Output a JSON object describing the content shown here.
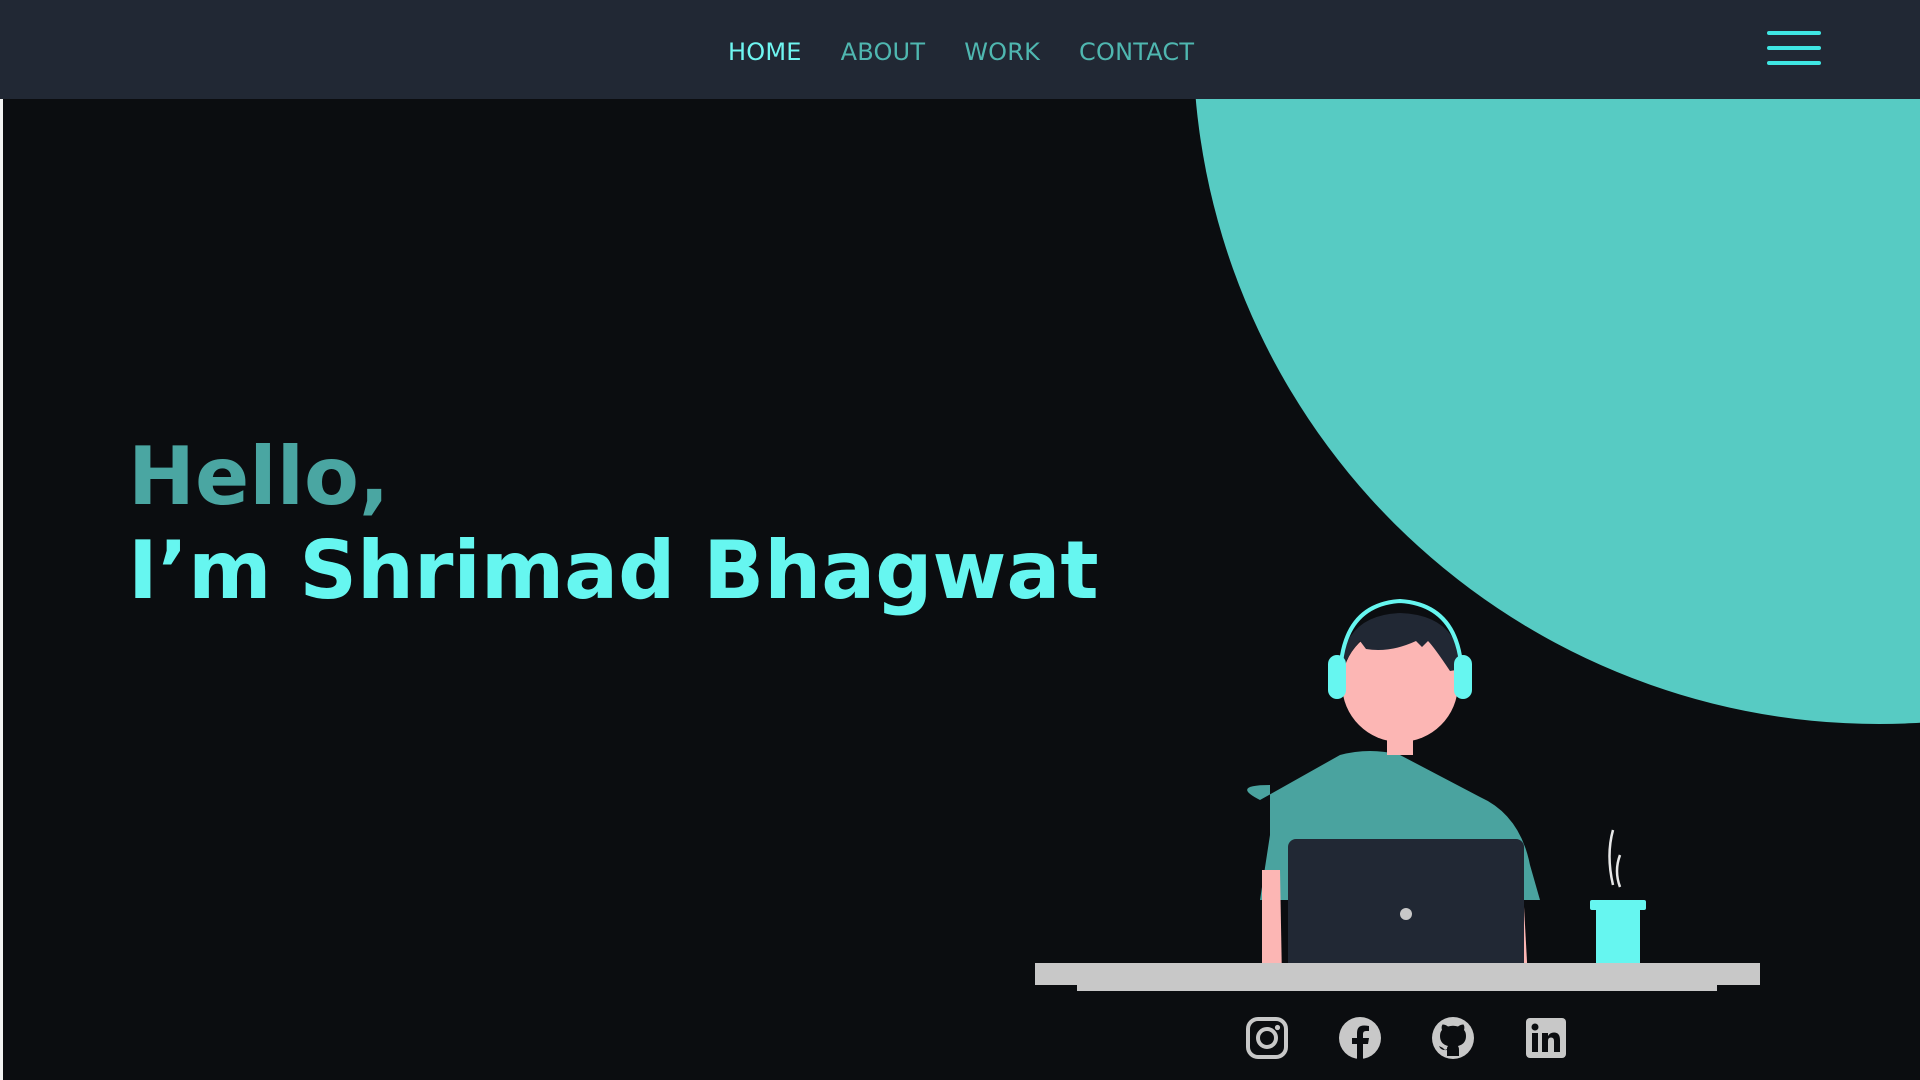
{
  "nav": {
    "links": [
      {
        "label": "HOME",
        "active": true
      },
      {
        "label": "ABOUT",
        "active": false
      },
      {
        "label": "WORK",
        "active": false
      },
      {
        "label": "CONTACT",
        "active": false
      }
    ],
    "menu_icon": "hamburger-menu-icon"
  },
  "hero": {
    "greeting": "Hello,",
    "intro": "I’m Shrimad Bhagwat"
  },
  "socials": [
    {
      "icon": "instagram-icon"
    },
    {
      "icon": "facebook-icon"
    },
    {
      "icon": "github-icon"
    },
    {
      "icon": "linkedin-icon"
    }
  ],
  "colors": {
    "navbar": "#212834",
    "background": "#0b0d10",
    "accent": "#66f6f0",
    "accent_dark": "#4aa6a2",
    "circle": "#57cbc3",
    "icon_gray": "#c8c8c8"
  }
}
